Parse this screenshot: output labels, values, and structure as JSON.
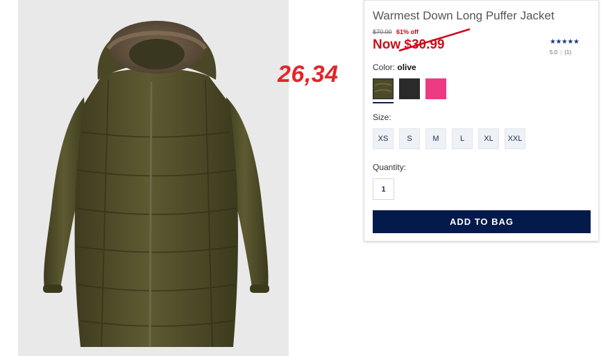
{
  "product": {
    "title": "Warmest Down Long Puffer Jacket",
    "original_price": "$70.00",
    "discount": "61% off",
    "now_price": "Now $30.99"
  },
  "rating": {
    "stars": "★★★★★",
    "score": "5.0",
    "count": "(1)"
  },
  "color": {
    "label": "Color:",
    "selected": "olive",
    "swatches": [
      {
        "name": "olive",
        "hex": "#4d4a2a"
      },
      {
        "name": "black",
        "hex": "#2a2a2a"
      },
      {
        "name": "pink",
        "hex": "#ee3a82"
      }
    ]
  },
  "size": {
    "label": "Size:",
    "options": [
      "XS",
      "S",
      "M",
      "L",
      "XL",
      "XXL"
    ]
  },
  "quantity": {
    "label": "Quantity:",
    "value": "1"
  },
  "add_to_bag_label": "ADD TO BAG",
  "annotation": "26,34",
  "colors": {
    "accent_navy": "#031a4b",
    "sale_red": "#c4121a",
    "annotation_red": "#e3262a"
  }
}
